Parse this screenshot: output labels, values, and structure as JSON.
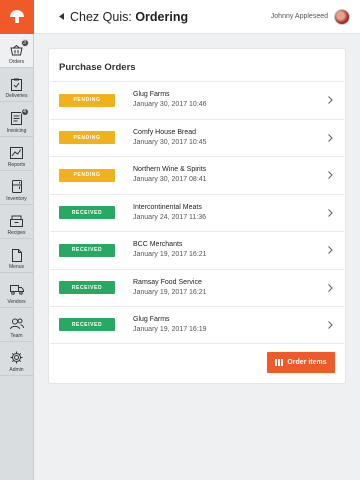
{
  "header": {
    "venue": "Chez Quis:",
    "page_title": "Ordering",
    "user_name": "Johnny Appleseed"
  },
  "sidebar": {
    "items": [
      {
        "label": "Orders",
        "icon": "basket-icon",
        "badge": "3",
        "active": true
      },
      {
        "label": "Deliveries",
        "icon": "clipboard-check-icon",
        "badge": "",
        "active": false
      },
      {
        "label": "Invoicing",
        "icon": "invoice-icon",
        "badge": "4",
        "active": false
      },
      {
        "label": "Reports",
        "icon": "chart-icon",
        "badge": "",
        "active": false
      },
      {
        "label": "Inventory",
        "icon": "fridge-icon",
        "badge": "",
        "active": false
      },
      {
        "label": "Recipes",
        "icon": "recipe-box-icon",
        "badge": "",
        "active": false
      },
      {
        "label": "Menus",
        "icon": "document-icon",
        "badge": "",
        "active": false
      },
      {
        "label": "Vendors",
        "icon": "truck-icon",
        "badge": "",
        "active": false
      },
      {
        "label": "Team",
        "icon": "users-icon",
        "badge": "",
        "active": false
      },
      {
        "label": "Admin",
        "icon": "gear-icon",
        "badge": "",
        "active": false
      }
    ]
  },
  "card": {
    "title": "Purchase Orders",
    "orders": [
      {
        "status": "PENDING",
        "supplier": "Glug Farms",
        "date": "January 30, 2017 10:46"
      },
      {
        "status": "PENDING",
        "supplier": "Comfy House Bread",
        "date": "January 30, 2017 10:45"
      },
      {
        "status": "PENDING",
        "supplier": "Northern Wine & Spirits",
        "date": "January 30, 2017 08:41"
      },
      {
        "status": "RECEIVED",
        "supplier": "Intercontinental Meats",
        "date": "January 24, 2017 11:36"
      },
      {
        "status": "RECEIVED",
        "supplier": "BCC Merchants",
        "date": "January 19, 2017 16:21"
      },
      {
        "status": "RECEIVED",
        "supplier": "Ramsay Food Service",
        "date": "January 19, 2017 16:21"
      },
      {
        "status": "RECEIVED",
        "supplier": "Glug Farms",
        "date": "January 19, 2017 16:19"
      }
    ],
    "order_button_label": "Order items"
  },
  "colors": {
    "brand": "#f05a28",
    "pending": "#efb21c",
    "received": "#28a863"
  }
}
